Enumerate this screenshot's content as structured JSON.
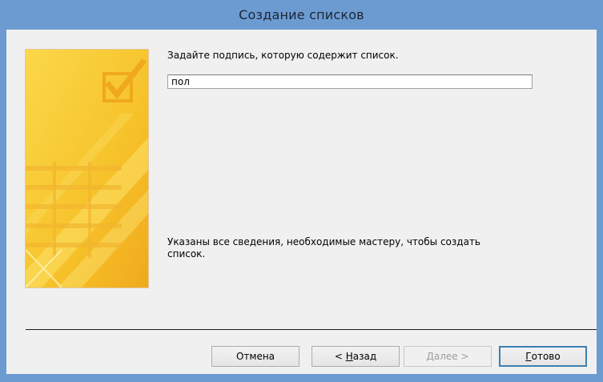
{
  "window": {
    "title": "Создание списков"
  },
  "wizard": {
    "prompt": "Задайте подпись, которую содержит список.",
    "caption_value": "пол",
    "info_line1": "Указаны все сведения, необходимые мастеру, чтобы создать",
    "info_line2": "список."
  },
  "buttons": {
    "cancel": "Отмена",
    "back_prefix": "< ",
    "back_hotkey": "Н",
    "back_rest": "азад",
    "next_hotkey": "Д",
    "next_rest": "алее >",
    "finish_hotkey": "Г",
    "finish_rest": "отово"
  },
  "icons": {
    "banner": "list-wizard-checkbox-illustration"
  },
  "colors": {
    "titlebar": "#6c9bd2",
    "banner_yellow": "#f7c52e",
    "dialog_bg": "#f0f0f0"
  }
}
